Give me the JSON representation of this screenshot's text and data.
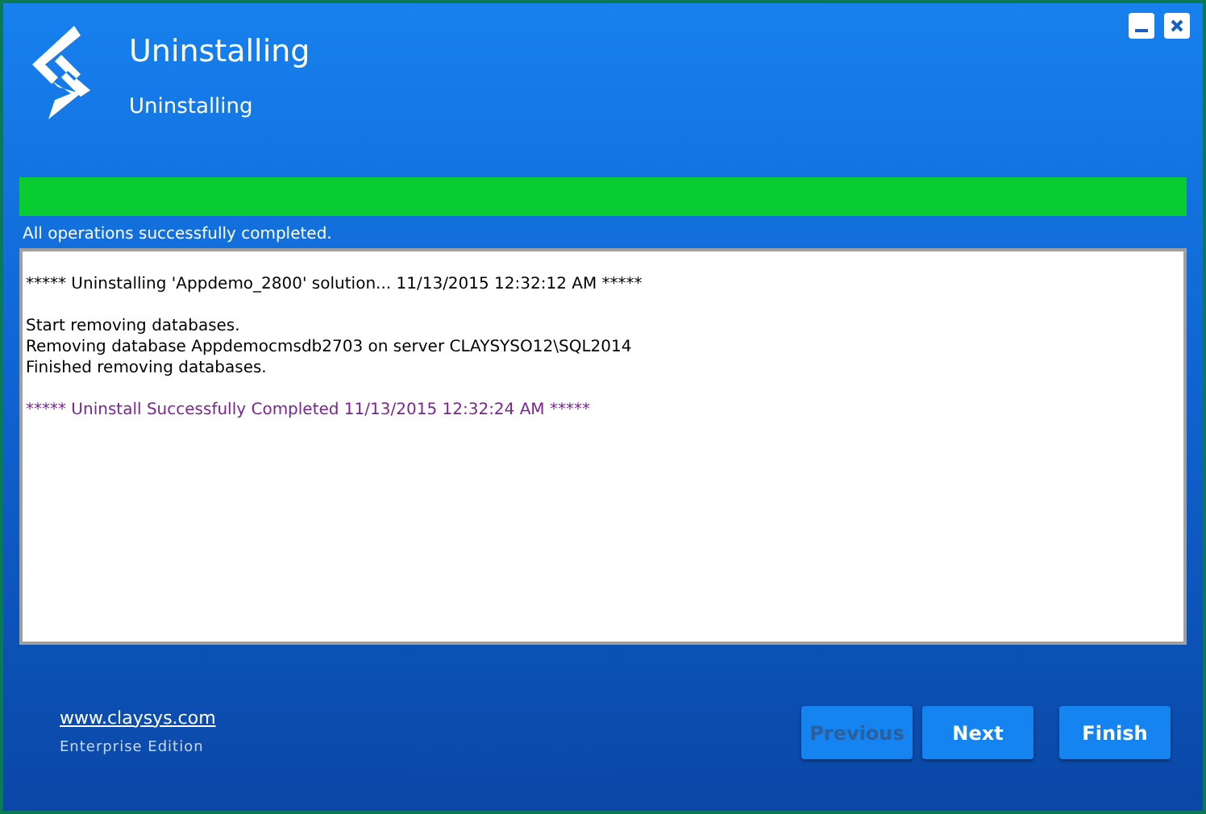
{
  "header": {
    "title": "Uninstalling",
    "subtitle": "Uninstalling"
  },
  "progress": {
    "level": 1,
    "status": "All operations successfully completed."
  },
  "log": [
    {
      "kind": "normal",
      "text": "***** Uninstalling 'Appdemo_2800' solution... 11/13/2015 12:32:12 AM *****"
    },
    {
      "kind": "blank"
    },
    {
      "kind": "normal",
      "text": "Start removing databases."
    },
    {
      "kind": "normal",
      "text": "Removing database Appdemocmsdb2703 on server CLAYSYSO12\\SQL2014"
    },
    {
      "kind": "normal",
      "text": "Finished removing databases."
    },
    {
      "kind": "blank"
    },
    {
      "kind": "success",
      "text": "***** Uninstall Successfully Completed 11/13/2015 12:32:24 AM *****"
    }
  ],
  "footer": {
    "link": "www.claysys.com",
    "edition": "Enterprise Edition"
  },
  "buttons": [
    {
      "label": "Previous",
      "disabled": true
    },
    {
      "label": "Next",
      "disabled": false
    },
    {
      "label": "Finish",
      "disabled": false
    }
  ]
}
